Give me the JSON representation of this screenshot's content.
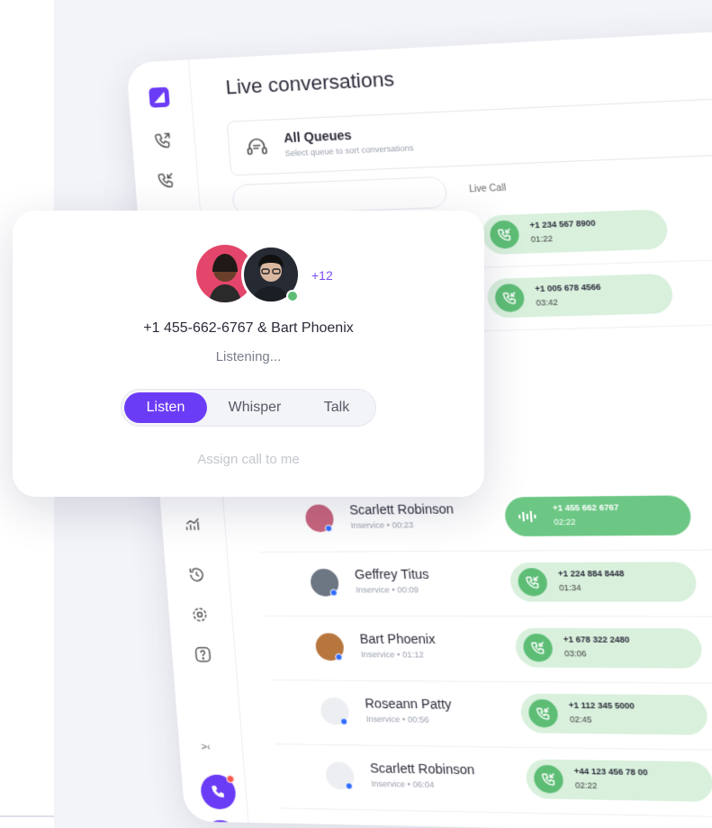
{
  "app": {
    "title": "Live conversations",
    "queue": {
      "label": "All Queues",
      "hint": "Select queue to sort conversations"
    },
    "columns": {
      "live_call": "Live Call",
      "live_call_2": "Li"
    },
    "live_calls": [
      {
        "number": "+1 234 567 8900",
        "duration": "01:22"
      },
      {
        "number": "+1 005 678 4566",
        "duration": "03:42"
      }
    ],
    "agents": [
      {
        "name": "Scarlett Robinson",
        "status": "Inservice • 00:23",
        "number": "+1 455 662 6767",
        "duration": "02:22",
        "active": true,
        "avatar_color": "#c9657e"
      },
      {
        "name": "Geffrey Titus",
        "status": "Inservice • 00:09",
        "number": "+1 224 884 8448",
        "duration": "01:34",
        "active": false,
        "avatar_color": "#6d7683"
      },
      {
        "name": "Bart Phoenix",
        "status": "Inservice • 01:12",
        "number": "+1 678 322 2480",
        "duration": "03:06",
        "active": false,
        "avatar_color": "#b8763f"
      },
      {
        "name": "Roseann Patty",
        "status": "Inservice • 00:56",
        "number": "+1 112 345 5000",
        "duration": "02:45",
        "active": false,
        "avatar_color": "#eceef2"
      },
      {
        "name": "Scarlett Robinson",
        "status": "Inservice • 06:04",
        "number": "+44 123 456 78 00",
        "duration": "02:22",
        "active": false,
        "avatar_color": "#eceef2"
      }
    ],
    "collapse_label": ">‹"
  },
  "popup": {
    "more_count": "+12",
    "participants": "+1 455-662-6767 & Bart Phoenix",
    "status": "Listening...",
    "modes": [
      "Listen",
      "Whisper",
      "Talk"
    ],
    "active_mode": "Listen",
    "assign_label": "Assign call to me"
  },
  "colors": {
    "accent": "#6b3cf5",
    "call_green": "#6cc784",
    "call_green_light": "#d8f0dc",
    "badge_red": "#ff5a4f"
  }
}
